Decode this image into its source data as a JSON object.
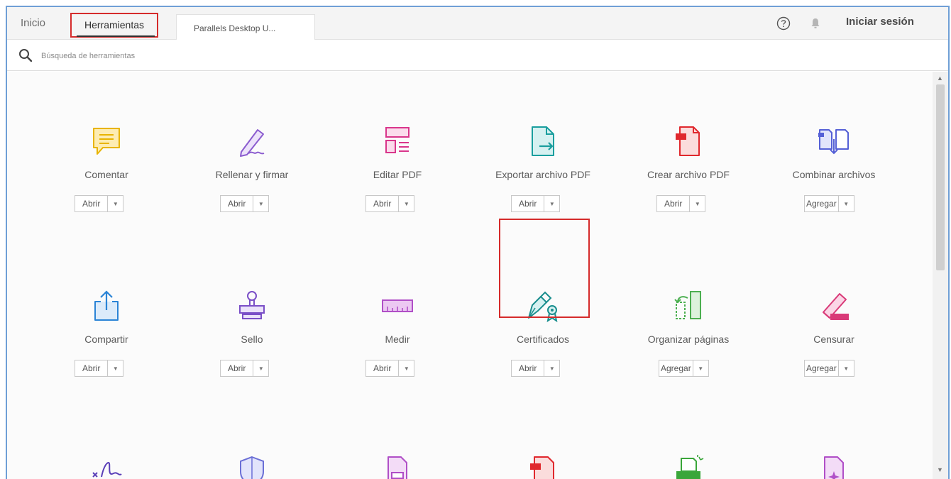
{
  "header": {
    "home_tab": "Inicio",
    "tools_tab": "Herramientas",
    "document_tab": "Parallels Desktop U...",
    "sign_in": "Iniciar sesión"
  },
  "search": {
    "placeholder": "Búsqueda de herramientas"
  },
  "tools": [
    {
      "name": "Comentar",
      "action": "Abrir",
      "icon": "comment-icon",
      "color": "#e8b400"
    },
    {
      "name": "Rellenar y firmar",
      "action": "Abrir",
      "icon": "fill-sign-icon",
      "color": "#8b5ccf"
    },
    {
      "name": "Editar PDF",
      "action": "Abrir",
      "icon": "edit-pdf-icon",
      "color": "#d9368b"
    },
    {
      "name": "Exportar archivo PDF",
      "action": "Abrir",
      "icon": "export-pdf-icon",
      "color": "#1a9e9e"
    },
    {
      "name": "Crear archivo PDF",
      "action": "Abrir",
      "icon": "create-pdf-icon",
      "color": "#e0282d"
    },
    {
      "name": "Combinar archivos",
      "action": "Agregar",
      "icon": "combine-files-icon",
      "color": "#5560d6"
    },
    {
      "name": "Compartir",
      "action": "Abrir",
      "icon": "share-icon",
      "color": "#2b84d6"
    },
    {
      "name": "Sello",
      "action": "Abrir",
      "icon": "stamp-icon",
      "color": "#7a4fc7"
    },
    {
      "name": "Medir",
      "action": "Abrir",
      "icon": "ruler-icon",
      "color": "#b04fc7"
    },
    {
      "name": "Certificados",
      "action": "Abrir",
      "icon": "certificate-pen-icon",
      "color": "#1a8e8e"
    },
    {
      "name": "Organizar páginas",
      "action": "Agregar",
      "icon": "organize-pages-icon",
      "color": "#4caf50"
    },
    {
      "name": "Censurar",
      "action": "Agregar",
      "icon": "redact-icon",
      "color": "#d93a78"
    }
  ],
  "partial_row_icons": [
    {
      "icon": "signature-icon",
      "color": "#5a3fb8"
    },
    {
      "icon": "shield-icon",
      "color": "#6b6fd6"
    },
    {
      "icon": "document-optimize-icon",
      "color": "#b04fc7"
    },
    {
      "icon": "pdf-document-icon",
      "color": "#e0282d"
    },
    {
      "icon": "print-production-icon",
      "color": "#3aa63a"
    },
    {
      "icon": "rich-media-icon",
      "color": "#b04fc7"
    }
  ]
}
